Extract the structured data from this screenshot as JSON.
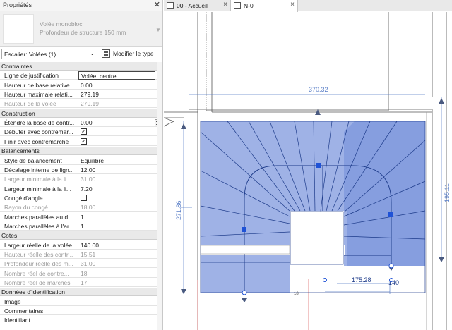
{
  "panel": {
    "title": "Propriétés",
    "close": "✕",
    "type_family": "Volée monobloc",
    "type_name": "Profondeur de structure 150 mm",
    "instance_selector": "Escalier: Volées (1)",
    "edit_type": "Modifier le type"
  },
  "properties": [
    {
      "kind": "cat",
      "label": "Contraintes"
    },
    {
      "kind": "prop",
      "name": "Ligne de justification",
      "value": "Volée: centre",
      "selected": true
    },
    {
      "kind": "prop",
      "name": "Hauteur de base relative",
      "value": "0.00"
    },
    {
      "kind": "prop",
      "name": "Hauteur maximale relati...",
      "value": "279.19"
    },
    {
      "kind": "prop",
      "name": "Hauteur de la volée",
      "value": "279.19",
      "dim": true
    },
    {
      "kind": "cat",
      "label": "Construction"
    },
    {
      "kind": "prop",
      "name": "Étendre la base de contr...",
      "value": "0.00",
      "stepper": true
    },
    {
      "kind": "check",
      "name": "Débuter avec contremar...",
      "checked": true
    },
    {
      "kind": "check",
      "name": "Finir avec contremarche",
      "checked": true
    },
    {
      "kind": "cat",
      "label": "Balancements"
    },
    {
      "kind": "prop",
      "name": "Style de balancement",
      "value": "Equilibré"
    },
    {
      "kind": "prop",
      "name": "Décalage interne de lign...",
      "value": "12.00"
    },
    {
      "kind": "prop",
      "name": "Largeur minimale à la li...",
      "value": "31.00",
      "dim": true
    },
    {
      "kind": "prop",
      "name": "Largeur minimale à la li...",
      "value": "7.20"
    },
    {
      "kind": "check",
      "name": "Congé d'angle",
      "checked": false
    },
    {
      "kind": "prop",
      "name": "Rayon du congé",
      "value": "18.00",
      "dim": true
    },
    {
      "kind": "prop",
      "name": "Marches parallèles au d...",
      "value": "1"
    },
    {
      "kind": "prop",
      "name": "Marches parallèles à l'ar...",
      "value": "1"
    },
    {
      "kind": "cat",
      "label": "Cotes"
    },
    {
      "kind": "prop",
      "name": "Largeur réelle de la volée",
      "value": "140.00"
    },
    {
      "kind": "prop",
      "name": "Hauteur réelle des contr...",
      "value": "15.51",
      "dim": true
    },
    {
      "kind": "prop",
      "name": "Profondeur réelle des m...",
      "value": "31.00",
      "dim": true
    },
    {
      "kind": "prop",
      "name": "Nombre réel de contre...",
      "value": "18",
      "dim": true
    },
    {
      "kind": "prop",
      "name": "Nombre réel de marches",
      "value": "17",
      "dim": true
    },
    {
      "kind": "cat",
      "label": "Données d'identification"
    },
    {
      "kind": "prop",
      "name": "Image",
      "value": ""
    },
    {
      "kind": "prop",
      "name": "Commentaires",
      "value": ""
    },
    {
      "kind": "prop",
      "name": "Identifiant",
      "value": ""
    }
  ],
  "tabs": [
    {
      "label": "00 - Accueil",
      "active": false
    },
    {
      "label": "N-0",
      "active": true
    }
  ],
  "drawing": {
    "dims": {
      "top": "370.32",
      "left": "271.86",
      "right": "195.11",
      "bottom1": "175.28",
      "bottom2": "140",
      "small": "18"
    },
    "colors": {
      "stair_fill": "#9fb2e6",
      "stair_fill_dark": "#7f99dd",
      "dim_line": "#5a7fc8",
      "grip": "#1f52d6",
      "arrow": "#4a5a80"
    }
  }
}
